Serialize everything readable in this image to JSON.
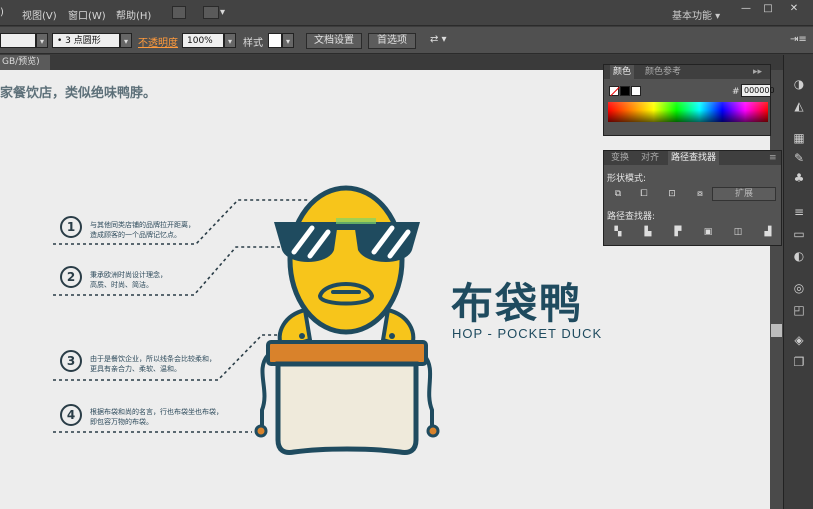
{
  "menu": {
    "items": [
      "视图(V)",
      "窗口(W)",
      "帮助(H)"
    ],
    "workspace": "基本功能",
    "window_controls": [
      "—",
      "□",
      "✕"
    ]
  },
  "control_bar": {
    "stroke_profile": "3 点圆形",
    "opacity_label": "不透明度",
    "opacity_value": "100%",
    "style_label": "样式",
    "doc_setup_button": "文档设置",
    "prefs_button": "首选项"
  },
  "document_tab": "GB/预览)",
  "canvas": {
    "caption": "家餐饮店，类似绝味鸭脖。",
    "annotations": [
      {
        "num": "1",
        "lines": [
          "与其他同类店铺的品牌拉开距离，",
          "造成顾客的一个品牌记忆点。"
        ]
      },
      {
        "num": "2",
        "lines": [
          "秉承欧洲时尚设计理念，",
          "高质、时尚、简洁。"
        ]
      },
      {
        "num": "3",
        "lines": [
          "由于是餐饮企业，所以线条会比较柔和，",
          "更具有亲合力、柔软、温和。"
        ]
      },
      {
        "num": "4",
        "lines": [
          "根据布袋和尚的名言，行也布袋坐也布袋，",
          "即包容万物的布袋。"
        ]
      }
    ],
    "brand_cn": "布袋鸭",
    "brand_en": "HOP - POCKET DUCK"
  },
  "color_panel": {
    "tabs": [
      "颜色",
      "颜色参考"
    ],
    "hex_label": "#",
    "hex_value": "000000"
  },
  "pathfinder_panel": {
    "tabs": [
      "变换",
      "对齐",
      "路径查找器"
    ],
    "shape_modes_label": "形状模式:",
    "pathfinders_label": "路径查找器:",
    "expand_button": "扩展"
  },
  "colors": {
    "duck_yellow": "#f7c51b",
    "navy": "#1f4b5f",
    "orange_band": "#d9822b",
    "bag_fill": "#efeadb"
  }
}
